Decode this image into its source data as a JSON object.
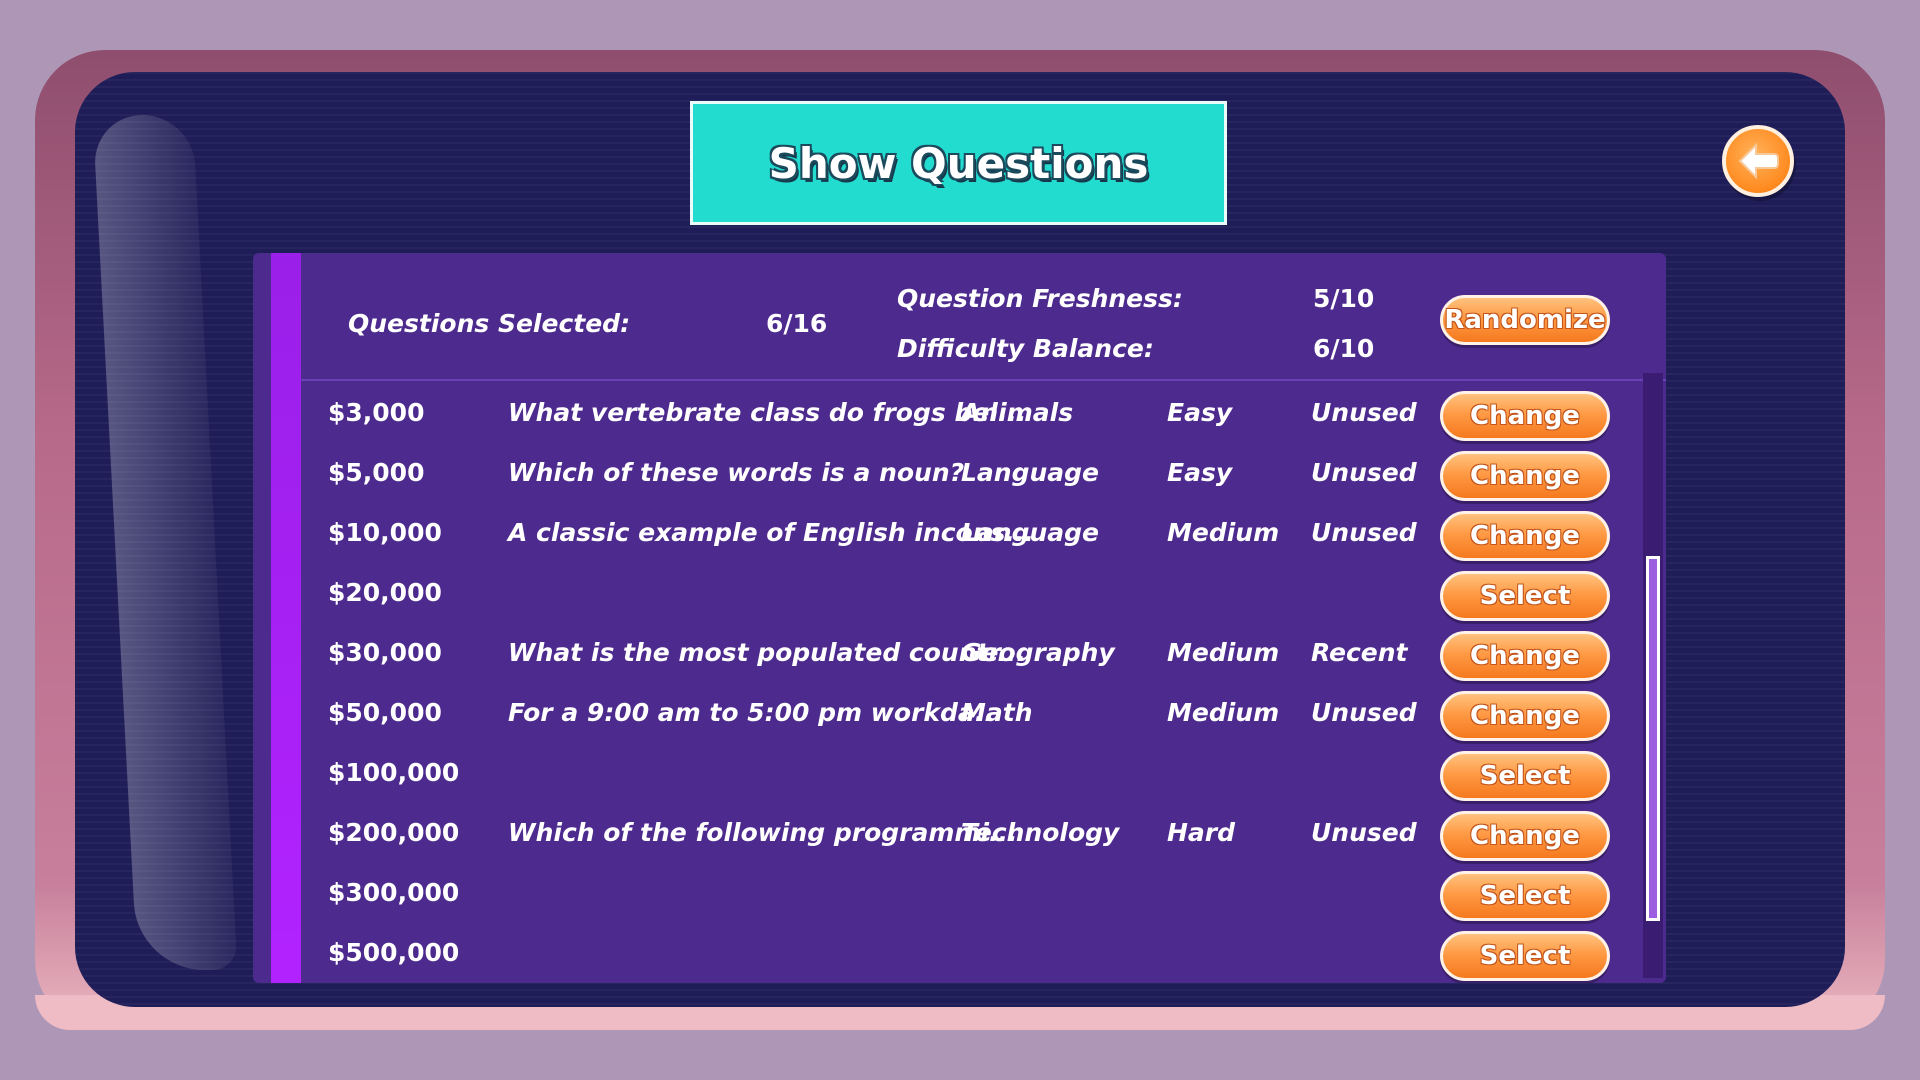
{
  "title": "Show Questions",
  "summary": {
    "questions_selected_label": "Questions Selected:",
    "questions_selected_value": "6/16",
    "freshness_label": "Question Freshness:",
    "freshness_value": "5/10",
    "balance_label": "Difficulty Balance:",
    "balance_value": "6/10",
    "randomize_label": "Randomize"
  },
  "rows": [
    {
      "amount": "$3,000",
      "question": "What vertebrate class do frogs bel...",
      "category": "Animals",
      "difficulty": "Easy",
      "status": "Unused",
      "action": "Change"
    },
    {
      "amount": "$5,000",
      "question": "Which of these words is a noun?",
      "category": "Language",
      "difficulty": "Easy",
      "status": "Unused",
      "action": "Change"
    },
    {
      "amount": "$10,000",
      "question": "A classic example of English incons...",
      "category": "Language",
      "difficulty": "Medium",
      "status": "Unused",
      "action": "Change"
    },
    {
      "amount": "$20,000",
      "question": "",
      "category": "",
      "difficulty": "",
      "status": "",
      "action": "Select"
    },
    {
      "amount": "$30,000",
      "question": "What is the most populated countr...",
      "category": "Geography",
      "difficulty": "Medium",
      "status": "Recent",
      "action": "Change"
    },
    {
      "amount": "$50,000",
      "question": "For a 9:00 am to 5:00 pm workda...",
      "category": "Math",
      "difficulty": "Medium",
      "status": "Unused",
      "action": "Change"
    },
    {
      "amount": "$100,000",
      "question": "",
      "category": "",
      "difficulty": "",
      "status": "",
      "action": "Select"
    },
    {
      "amount": "$200,000",
      "question": "Which of the following programmi...",
      "category": "Technology",
      "difficulty": "Hard",
      "status": "Unused",
      "action": "Change"
    },
    {
      "amount": "$300,000",
      "question": "",
      "category": "",
      "difficulty": "",
      "status": "",
      "action": "Select"
    },
    {
      "amount": "$500,000",
      "question": "",
      "category": "",
      "difficulty": "",
      "status": "",
      "action": "Select"
    }
  ],
  "icons": {
    "back": "back-arrow-icon"
  },
  "colors": {
    "accent": "#23dcd0",
    "button": "#ff9a45",
    "panel": "#4d2a8e",
    "screen": "#1f1d57"
  }
}
